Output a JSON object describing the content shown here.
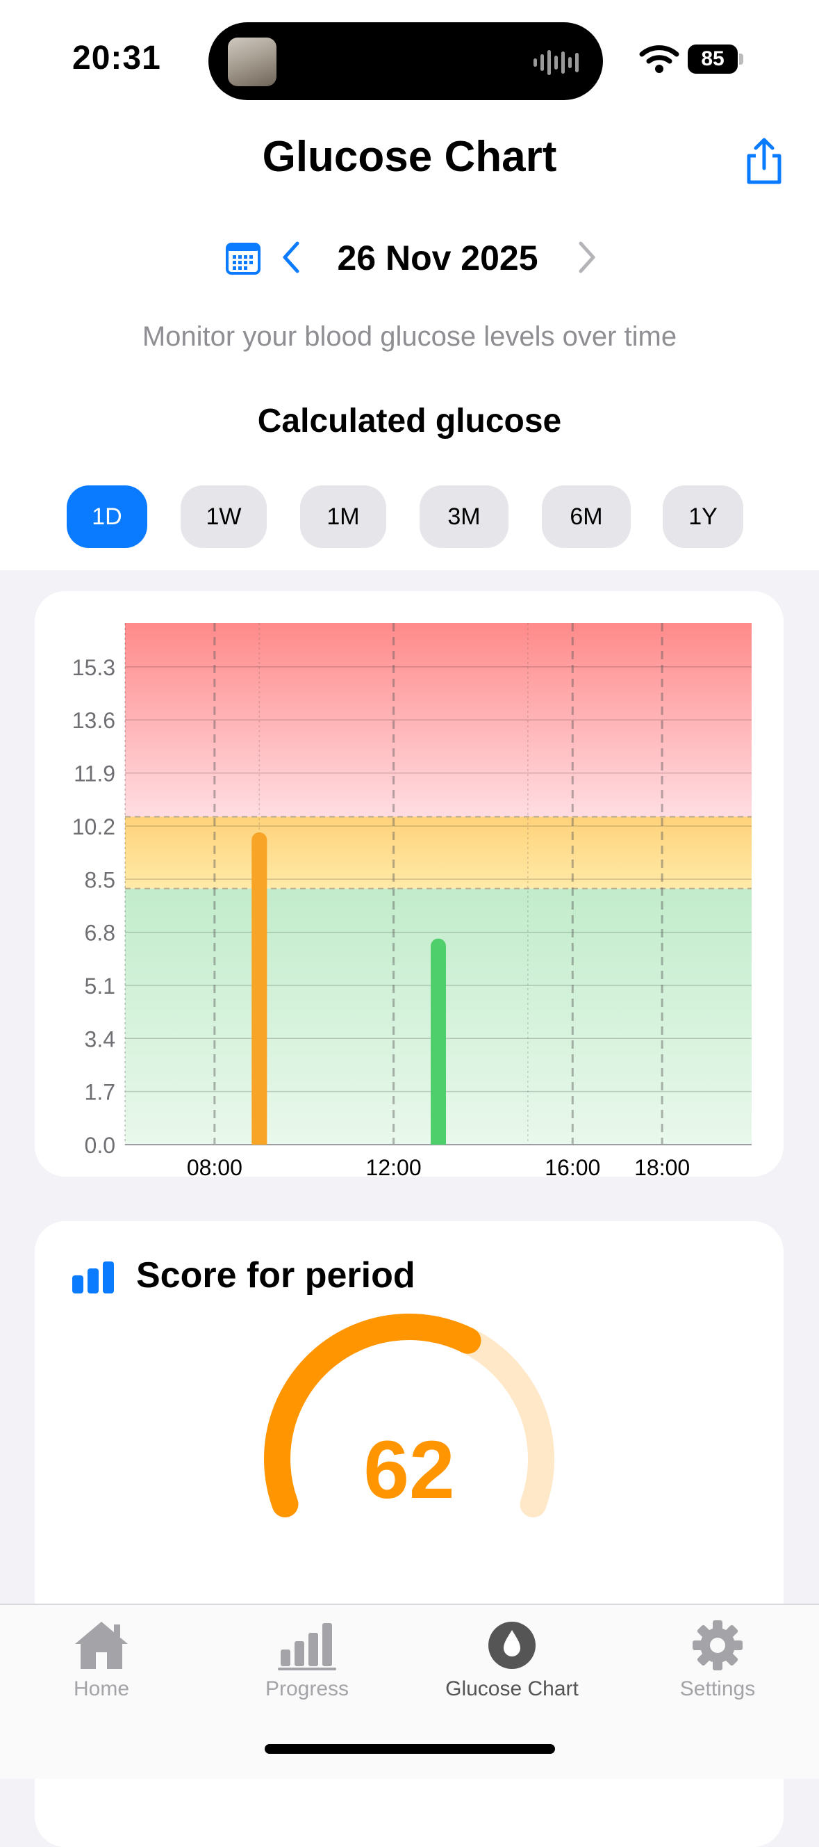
{
  "status_bar": {
    "time": "20:31",
    "battery": "85"
  },
  "header": {
    "title": "Glucose Chart",
    "share_icon": "share-icon"
  },
  "date_nav": {
    "date": "26 Nov 2025",
    "calendar_icon": "calendar-icon",
    "prev_icon": "chevron-left-icon",
    "next_icon": "chevron-right-icon"
  },
  "subtitle": "Monitor your blood glucose levels over time",
  "section_title": "Calculated glucose",
  "range_tabs": [
    {
      "label": "1D",
      "active": true
    },
    {
      "label": "1W",
      "active": false
    },
    {
      "label": "1M",
      "active": false
    },
    {
      "label": "3M",
      "active": false
    },
    {
      "label": "6M",
      "active": false
    },
    {
      "label": "1Y",
      "active": false
    }
  ],
  "chart_data": {
    "type": "bar",
    "y_ticks": [
      "15.3",
      "13.6",
      "11.9",
      "10.2",
      "8.5",
      "6.8",
      "5.1",
      "3.4",
      "1.7",
      "0.0"
    ],
    "ylim": [
      0,
      16.7
    ],
    "x_ticks": [
      "08:00",
      "12:00",
      "16:00",
      "18:00"
    ],
    "xlim_hours": [
      6,
      20
    ],
    "vertical_gridlines_hours": [
      8,
      12,
      16,
      18
    ],
    "zones": [
      {
        "name": "high",
        "from": 10.5,
        "to": 16.7,
        "color": "#ff8a8a"
      },
      {
        "name": "elevated",
        "from": 8.2,
        "to": 10.5,
        "color": "#ffd37a"
      },
      {
        "name": "normal",
        "from": 0,
        "to": 8.2,
        "color": "#c4eccb"
      }
    ],
    "series": [
      {
        "time": "09:00",
        "hour": 9.0,
        "value": 10.0,
        "color": "#f7a427"
      },
      {
        "time": "13:00",
        "hour": 13.0,
        "value": 6.6,
        "color": "#4fcf6b"
      }
    ],
    "grid": true
  },
  "score": {
    "title": "Score for period",
    "value": "62",
    "fraction": 0.62,
    "icon": "bar-chart-icon"
  },
  "tab_bar": [
    {
      "label": "Home",
      "icon": "home-icon",
      "active": false
    },
    {
      "label": "Progress",
      "icon": "progress-icon",
      "active": false
    },
    {
      "label": "Glucose Chart",
      "icon": "drop-icon",
      "active": true
    },
    {
      "label": "Settings",
      "icon": "gear-icon",
      "active": false
    }
  ]
}
